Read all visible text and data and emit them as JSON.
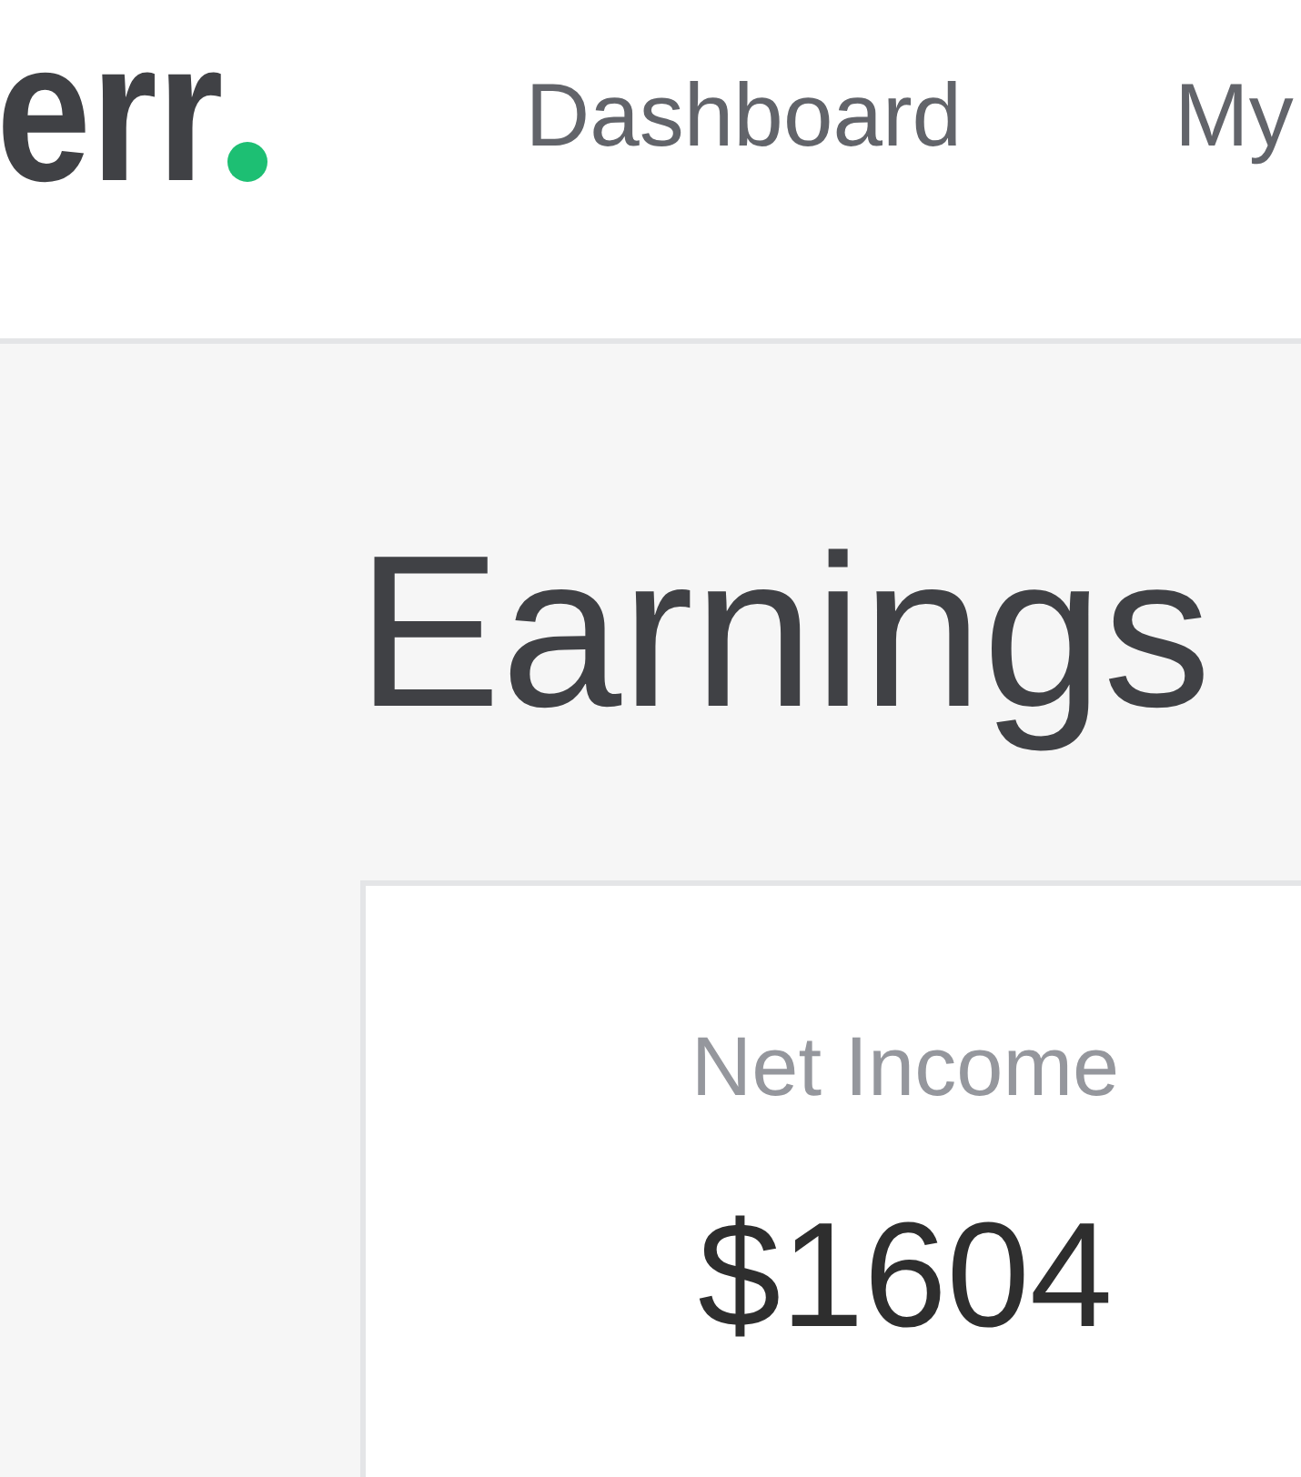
{
  "header": {
    "logo": {
      "text": "err"
    },
    "nav": [
      {
        "label": "Dashboard"
      },
      {
        "label": "My"
      }
    ]
  },
  "page": {
    "title": "Earnings"
  },
  "cards": [
    {
      "label": "Net Income",
      "value": "$1604"
    }
  ]
}
